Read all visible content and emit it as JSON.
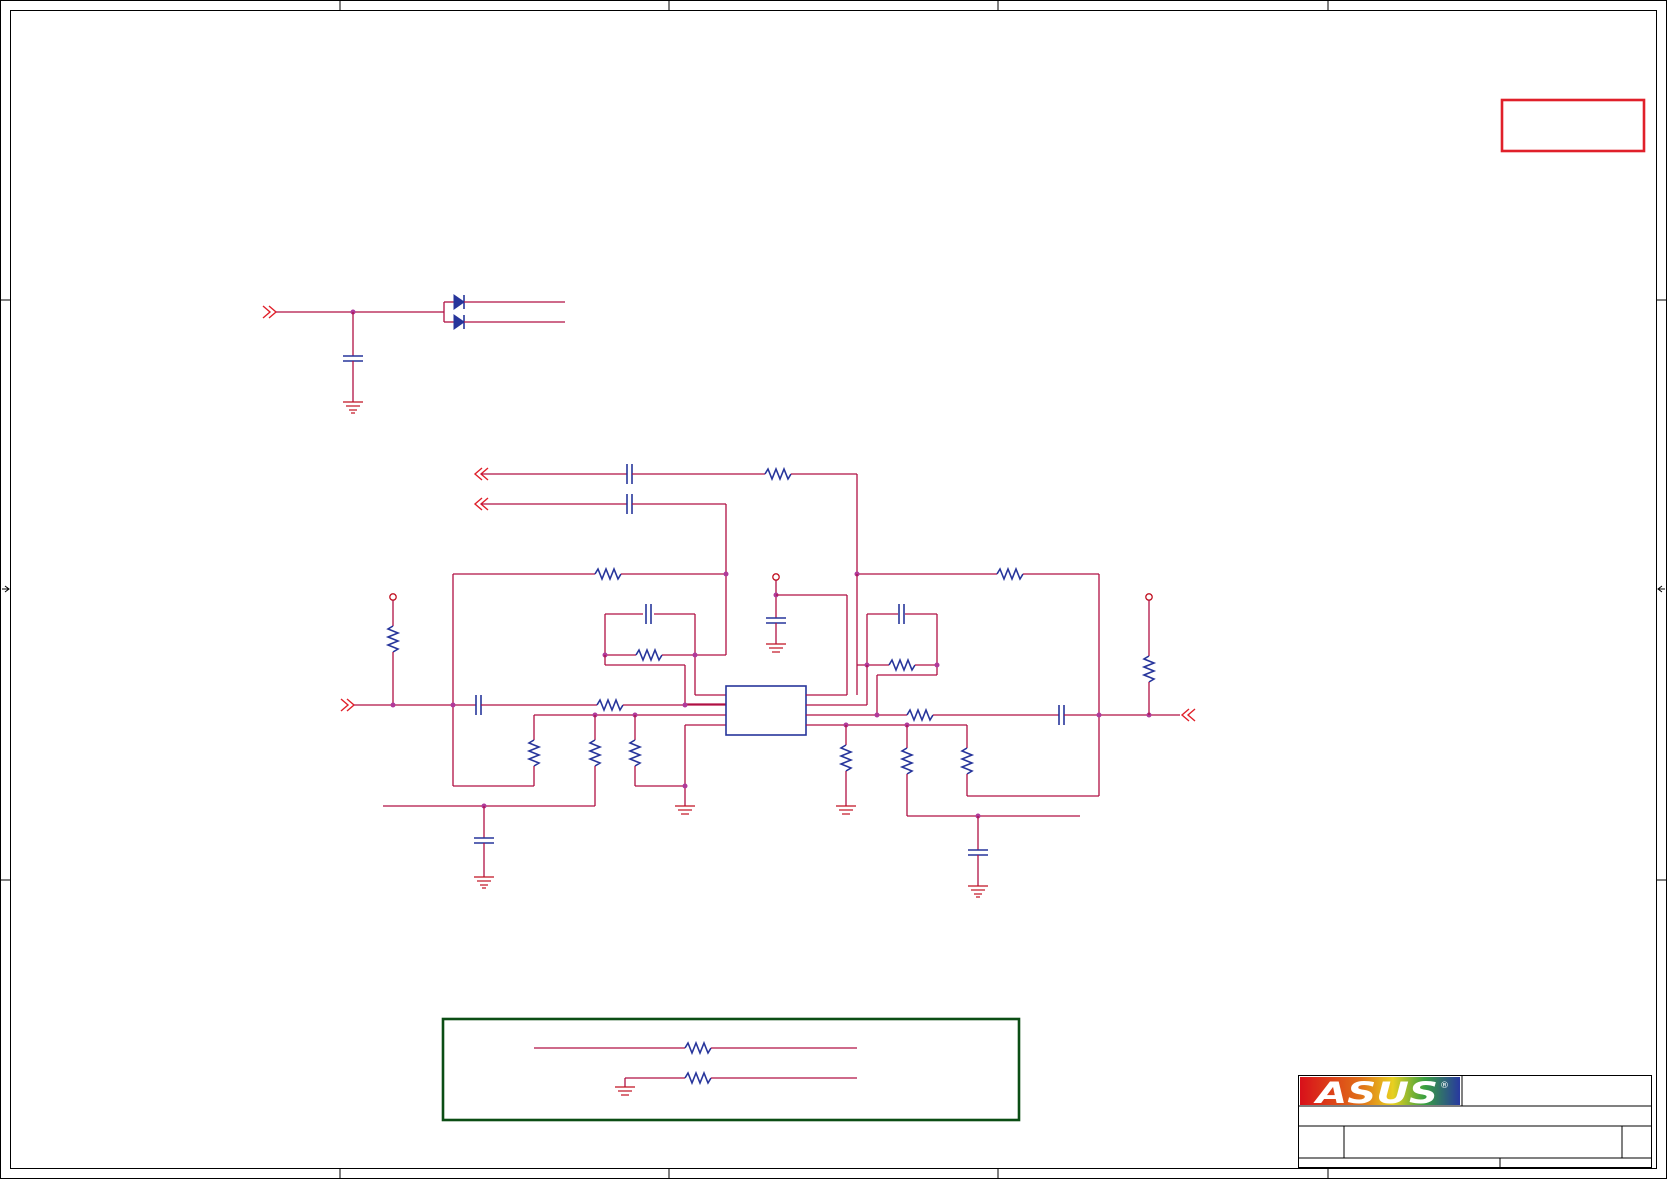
{
  "logo": {
    "brand_text": "ASUS",
    "registered_mark": "®",
    "gradient_colors": [
      "#d8101a",
      "#e07018",
      "#e8d020",
      "#38a040",
      "#2838a0"
    ]
  },
  "colors": {
    "wire": "#b01043",
    "component": "#27359b",
    "port": "#e0202a",
    "junction": "#b03a9a",
    "note_box": "#e0202a",
    "option_box": "#0b4d14"
  },
  "components": {
    "diode_pair": "diode-icon",
    "op_amp_ic": "ic-chip",
    "resistor": "resistor-icon",
    "capacitor": "capacitor-icon",
    "ground": "ground-icon",
    "power": "power-rail-icon",
    "port": "offpage-connector-icon"
  }
}
